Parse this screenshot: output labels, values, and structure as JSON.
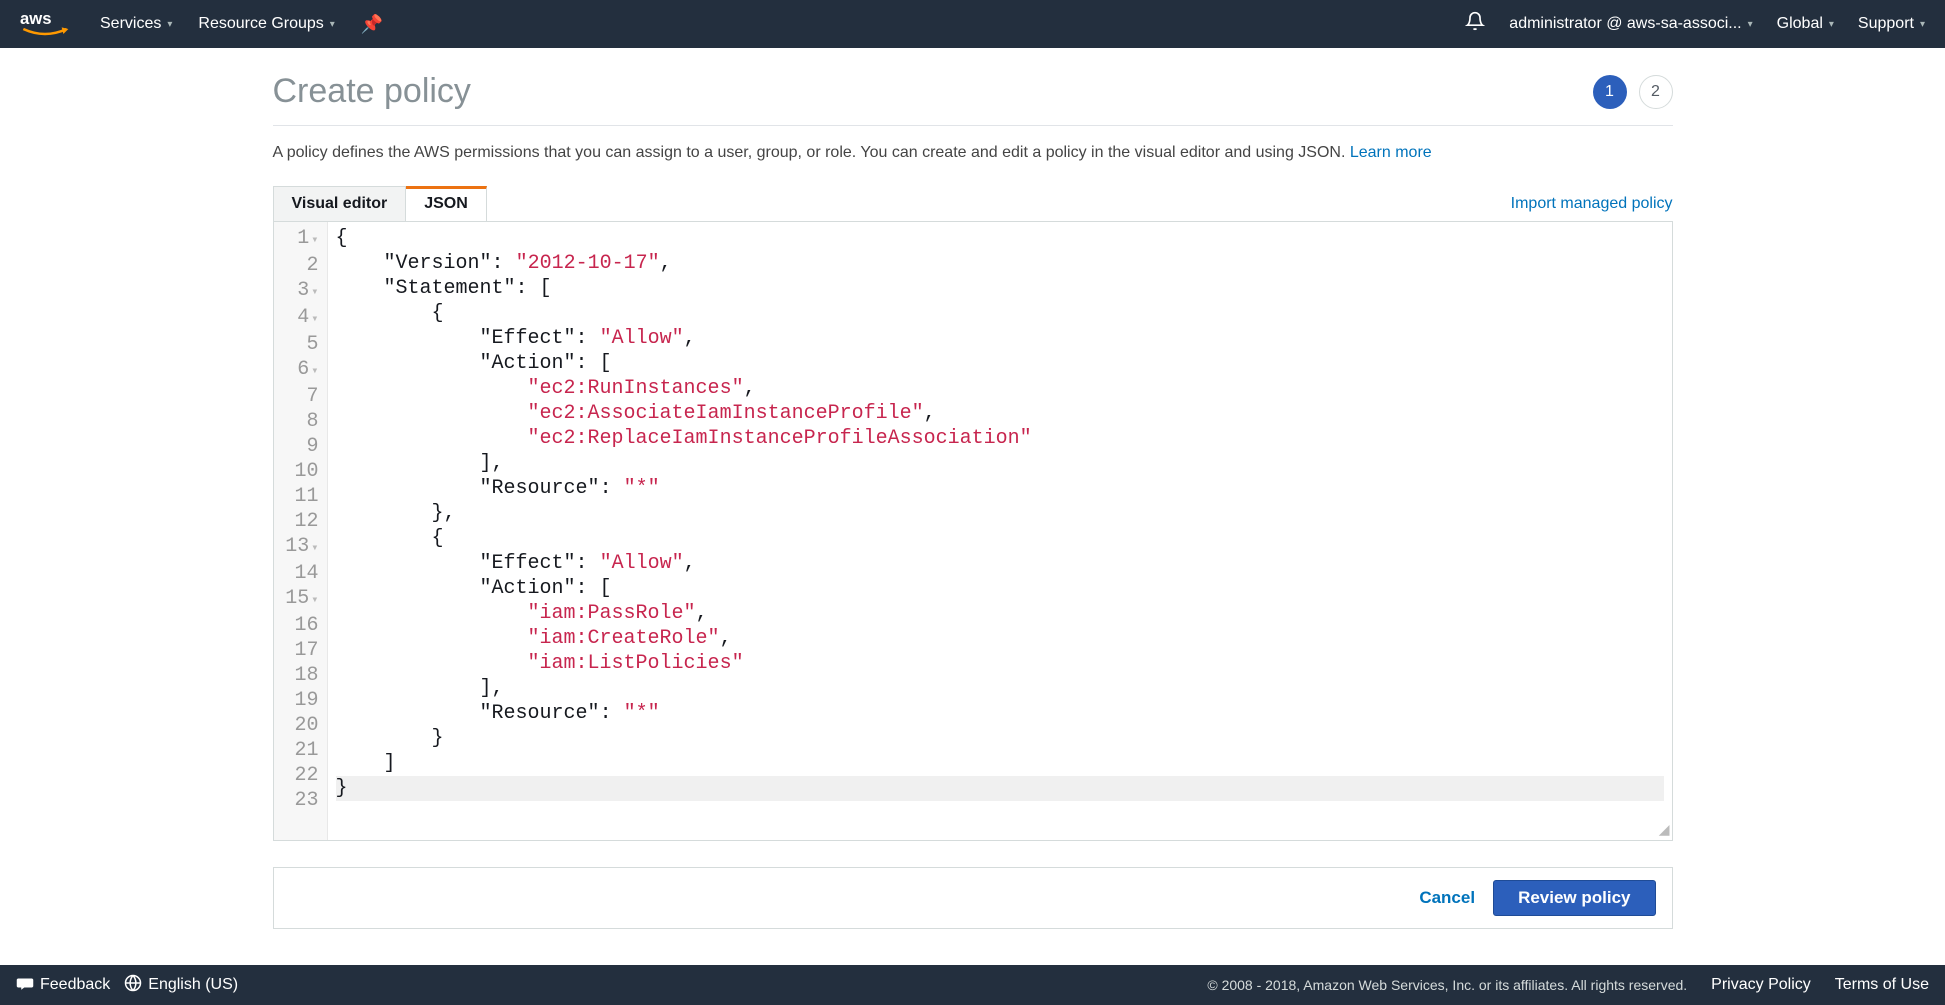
{
  "topnav": {
    "services": "Services",
    "resource_groups": "Resource Groups",
    "account": "administrator @ aws-sa-associ...",
    "region": "Global",
    "support": "Support"
  },
  "header": {
    "title": "Create policy",
    "step_active": "1",
    "step_next": "2"
  },
  "intro": {
    "text": "A policy defines the AWS permissions that you can assign to a user, group, or role. You can create and edit a policy in the visual editor and using JSON. ",
    "learn_more": "Learn more"
  },
  "tabs": {
    "visual": "Visual editor",
    "json": "JSON",
    "import": "Import managed policy"
  },
  "editor": {
    "lines": [
      {
        "n": "1",
        "fold": true,
        "tokens": [
          [
            "punct",
            "{"
          ]
        ]
      },
      {
        "n": "2",
        "fold": false,
        "tokens": [
          [
            "plain",
            "    "
          ],
          [
            "key",
            "\"Version\""
          ],
          [
            "punct",
            ": "
          ],
          [
            "str",
            "\"2012-10-17\""
          ],
          [
            "punct",
            ","
          ]
        ]
      },
      {
        "n": "3",
        "fold": true,
        "tokens": [
          [
            "plain",
            "    "
          ],
          [
            "key",
            "\"Statement\""
          ],
          [
            "punct",
            ": ["
          ]
        ]
      },
      {
        "n": "4",
        "fold": true,
        "tokens": [
          [
            "plain",
            "        "
          ],
          [
            "punct",
            "{"
          ]
        ]
      },
      {
        "n": "5",
        "fold": false,
        "tokens": [
          [
            "plain",
            "            "
          ],
          [
            "key",
            "\"Effect\""
          ],
          [
            "punct",
            ": "
          ],
          [
            "str",
            "\"Allow\""
          ],
          [
            "punct",
            ","
          ]
        ]
      },
      {
        "n": "6",
        "fold": true,
        "tokens": [
          [
            "plain",
            "            "
          ],
          [
            "key",
            "\"Action\""
          ],
          [
            "punct",
            ": ["
          ]
        ]
      },
      {
        "n": "7",
        "fold": false,
        "tokens": [
          [
            "plain",
            "                "
          ],
          [
            "str",
            "\"ec2:RunInstances\""
          ],
          [
            "punct",
            ","
          ]
        ]
      },
      {
        "n": "8",
        "fold": false,
        "tokens": [
          [
            "plain",
            "                "
          ],
          [
            "str",
            "\"ec2:AssociateIamInstanceProfile\""
          ],
          [
            "punct",
            ","
          ]
        ]
      },
      {
        "n": "9",
        "fold": false,
        "tokens": [
          [
            "plain",
            "                "
          ],
          [
            "str",
            "\"ec2:ReplaceIamInstanceProfileAssociation\""
          ]
        ]
      },
      {
        "n": "10",
        "fold": false,
        "tokens": [
          [
            "plain",
            "            "
          ],
          [
            "punct",
            "],"
          ]
        ]
      },
      {
        "n": "11",
        "fold": false,
        "tokens": [
          [
            "plain",
            "            "
          ],
          [
            "key",
            "\"Resource\""
          ],
          [
            "punct",
            ": "
          ],
          [
            "str",
            "\"*\""
          ]
        ]
      },
      {
        "n": "12",
        "fold": false,
        "tokens": [
          [
            "plain",
            "        "
          ],
          [
            "punct",
            "},"
          ]
        ]
      },
      {
        "n": "13",
        "fold": true,
        "tokens": [
          [
            "plain",
            "        "
          ],
          [
            "punct",
            "{"
          ]
        ]
      },
      {
        "n": "14",
        "fold": false,
        "tokens": [
          [
            "plain",
            "            "
          ],
          [
            "key",
            "\"Effect\""
          ],
          [
            "punct",
            ": "
          ],
          [
            "str",
            "\"Allow\""
          ],
          [
            "punct",
            ","
          ]
        ]
      },
      {
        "n": "15",
        "fold": true,
        "tokens": [
          [
            "plain",
            "            "
          ],
          [
            "key",
            "\"Action\""
          ],
          [
            "punct",
            ": ["
          ]
        ]
      },
      {
        "n": "16",
        "fold": false,
        "tokens": [
          [
            "plain",
            "                "
          ],
          [
            "str",
            "\"iam:PassRole\""
          ],
          [
            "punct",
            ","
          ]
        ]
      },
      {
        "n": "17",
        "fold": false,
        "tokens": [
          [
            "plain",
            "                "
          ],
          [
            "str",
            "\"iam:CreateRole\""
          ],
          [
            "punct",
            ","
          ]
        ]
      },
      {
        "n": "18",
        "fold": false,
        "tokens": [
          [
            "plain",
            "                "
          ],
          [
            "str",
            "\"iam:ListPolicies\""
          ]
        ]
      },
      {
        "n": "19",
        "fold": false,
        "tokens": [
          [
            "plain",
            "            "
          ],
          [
            "punct",
            "],"
          ]
        ]
      },
      {
        "n": "20",
        "fold": false,
        "tokens": [
          [
            "plain",
            "            "
          ],
          [
            "key",
            "\"Resource\""
          ],
          [
            "punct",
            ": "
          ],
          [
            "str",
            "\"*\""
          ]
        ]
      },
      {
        "n": "21",
        "fold": false,
        "tokens": [
          [
            "plain",
            "        "
          ],
          [
            "punct",
            "}"
          ]
        ]
      },
      {
        "n": "22",
        "fold": false,
        "tokens": [
          [
            "plain",
            "    "
          ],
          [
            "punct",
            "]"
          ]
        ]
      },
      {
        "n": "23",
        "fold": false,
        "active": true,
        "tokens": [
          [
            "punct",
            "}"
          ]
        ]
      }
    ]
  },
  "actions": {
    "cancel": "Cancel",
    "review": "Review policy"
  },
  "footer": {
    "feedback": "Feedback",
    "language": "English (US)",
    "copyright": "© 2008 - 2018, Amazon Web Services, Inc. or its affiliates. All rights reserved.",
    "privacy": "Privacy Policy",
    "terms": "Terms of Use"
  }
}
